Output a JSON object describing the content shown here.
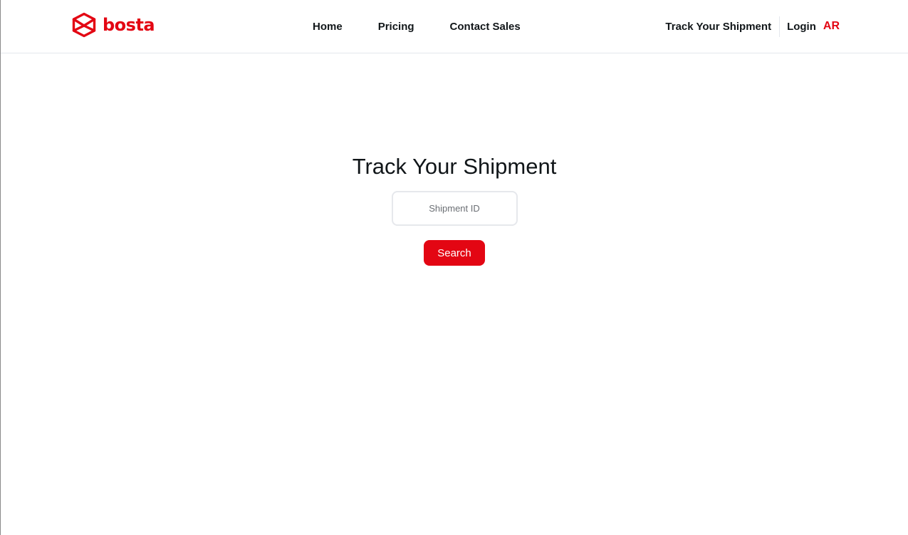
{
  "colors": {
    "brand": "#e30613",
    "text": "#111619",
    "border": "#e4e7ec"
  },
  "header": {
    "logo": {
      "icon": "bosta-box-icon",
      "text": "bosta"
    },
    "nav": [
      {
        "label": "Home"
      },
      {
        "label": "Pricing"
      },
      {
        "label": "Contact Sales"
      }
    ],
    "track_link": "Track Your Shipment",
    "login_label": "Login",
    "language_label": "AR"
  },
  "main": {
    "title": "Track Your Shipment",
    "search": {
      "placeholder": "Shipment ID",
      "value": ""
    },
    "search_button": "Search"
  }
}
